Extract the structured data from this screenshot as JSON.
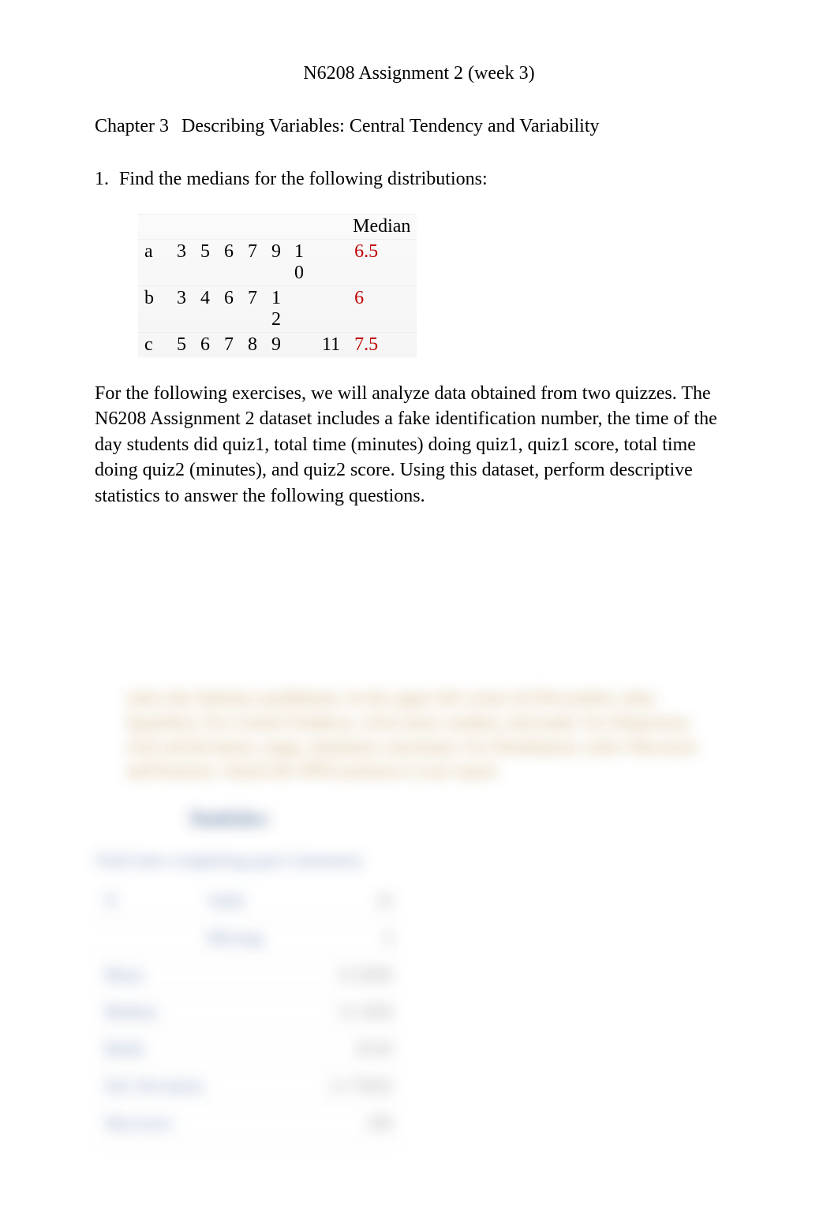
{
  "title": "N6208 Assignment 2 (week 3)",
  "chapter": {
    "label": "Chapter 3",
    "text": "Describing Variables: Central Tendency and Variability"
  },
  "question1": {
    "num": "1.",
    "text": "Find the medians for the following distributions:"
  },
  "median_table": {
    "header": "Median",
    "rows": [
      {
        "label": "a",
        "values": [
          "3",
          "5",
          "6",
          "7",
          "9"
        ],
        "extra1": "1",
        "extra1b": "0",
        "extra2": "",
        "median": "6.5"
      },
      {
        "label": "b",
        "values": [
          "3",
          "4",
          "6",
          "7",
          "1"
        ],
        "extra1": "",
        "extra1b": "2",
        "extra2": "",
        "median": "6"
      },
      {
        "label": "c",
        "values": [
          "5",
          "6",
          "7",
          "8",
          "9"
        ],
        "extra1": "",
        "extra1b": "",
        "extra2": "11",
        "median": "7.5"
      }
    ]
  },
  "paragraph": "For the following exercises, we will analyze data obtained from two quizzes. The N6208 Assignment 2 dataset includes a fake identification number, the time of the day students did quiz1, total time (minutes) doing quiz1, quiz1 score, total time doing quiz2 (minutes), and quiz2 score. Using this dataset, perform descriptive statistics to answer the following questions.",
  "blurred": {
    "instr": "select the Statistics pushbutton. In the upper left corner (of Percentiles value Quartiles). For Central Tendency, click mean, median, and mode. For Dispersion, click std deviation, range, minimum, maximum. For Distribution, select Skewness and Kurtosis. Attach the SPSS printout to your report.",
    "stats_header": "Statistics",
    "stats_subtitle": "Total time completing quiz1 (minutes)",
    "rows": [
      {
        "label": "N",
        "sub": "Valid",
        "value": "20"
      },
      {
        "label": "",
        "sub": "Missing",
        "value": "0"
      },
      {
        "label": "Mean",
        "sub": "",
        "value": "32.6000"
      },
      {
        "label": "Median",
        "sub": "",
        "value": "31.5000"
      },
      {
        "label": "Mode",
        "sub": "",
        "value": "30.00"
      },
      {
        "label": "Std. Deviation",
        "sub": "",
        "value": "12.70820"
      },
      {
        "label": "Skewness",
        "sub": "",
        "value": ".580"
      }
    ]
  }
}
